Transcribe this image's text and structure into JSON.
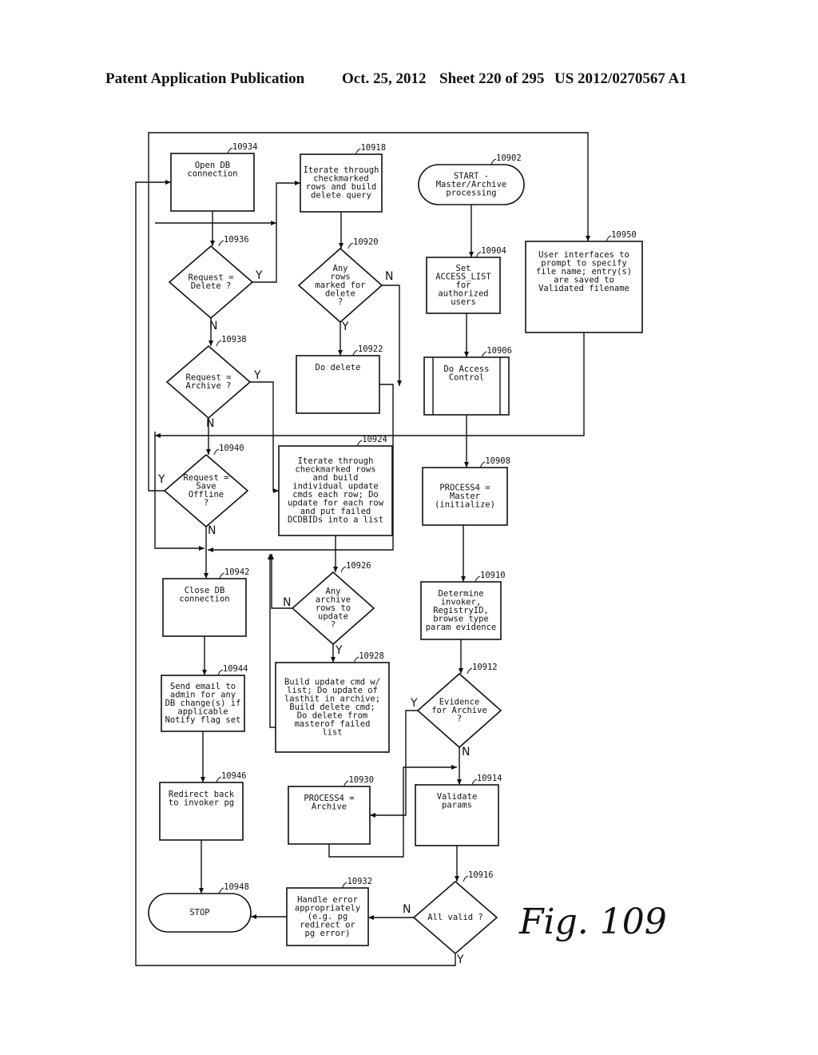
{
  "header": {
    "publication": "Patent Application Publication",
    "date": "Oct. 25, 2012",
    "sheet": "Sheet 220 of 295",
    "patent_number": "US 2012/0270567 A1"
  },
  "figure_label": "Fig. 109",
  "nodes": {
    "n10902": {
      "ref": "10902",
      "type": "terminal",
      "lines": [
        "START -",
        "Master/Archive",
        "processing"
      ]
    },
    "n10904": {
      "ref": "10904",
      "type": "process",
      "lines": [
        "Set",
        "ACCESS_LIST",
        "for",
        "authorized",
        "users"
      ]
    },
    "n10906": {
      "ref": "10906",
      "type": "predefined-process",
      "lines": [
        "Do Access",
        "Control"
      ]
    },
    "n10908": {
      "ref": "10908",
      "type": "process",
      "lines": [
        "PROCESS4 =",
        "Master",
        "(initialize)"
      ]
    },
    "n10910": {
      "ref": "10910",
      "type": "process",
      "lines": [
        "Determine",
        "invoker,",
        "RegistryID,",
        "browse type",
        "param evidence"
      ]
    },
    "n10912": {
      "ref": "10912",
      "type": "decision",
      "lines": [
        "Evidence",
        "for Archive",
        "?"
      ]
    },
    "n10914": {
      "ref": "10914",
      "type": "process",
      "lines": [
        "Validate",
        "params"
      ]
    },
    "n10916": {
      "ref": "10916",
      "type": "decision",
      "lines": [
        "All valid ?"
      ]
    },
    "n10918": {
      "ref": "10918",
      "type": "process",
      "lines": [
        "Iterate through",
        "checkmarked",
        "rows and build",
        "delete query"
      ]
    },
    "n10920": {
      "ref": "10920",
      "type": "decision",
      "lines": [
        "Any",
        "rows",
        "marked for",
        "delete",
        "?"
      ]
    },
    "n10922": {
      "ref": "10922",
      "type": "process",
      "lines": [
        "Do delete"
      ]
    },
    "n10924": {
      "ref": "10924",
      "type": "process",
      "lines": [
        "Iterate through",
        "checkmarked rows",
        "and build",
        "individual update",
        "cmds each row; Do",
        "update for each row",
        "and put failed",
        "DCDBIDs into a list"
      ]
    },
    "n10926": {
      "ref": "10926",
      "type": "decision",
      "lines": [
        "Any",
        "archive",
        "rows to",
        "update",
        "?"
      ]
    },
    "n10928": {
      "ref": "10928",
      "type": "process",
      "lines": [
        "Build update cmd w/",
        "list; Do update of",
        "lasthit in archive;",
        "Build delete cmd;",
        "Do delete from",
        "masterof failed",
        "list"
      ]
    },
    "n10930": {
      "ref": "10930",
      "type": "process",
      "lines": [
        "PROCESS4 =",
        "Archive"
      ]
    },
    "n10932": {
      "ref": "10932",
      "type": "process",
      "lines": [
        "Handle error",
        "appropriately",
        "(e.g. pg",
        "redirect or",
        "pg error)"
      ]
    },
    "n10934": {
      "ref": "10934",
      "type": "process",
      "lines": [
        "Open DB",
        "connection"
      ]
    },
    "n10936": {
      "ref": "10936",
      "type": "decision",
      "lines": [
        "Request =",
        "Delete ?"
      ]
    },
    "n10938": {
      "ref": "10938",
      "type": "decision",
      "lines": [
        "Request =",
        "Archive ?"
      ]
    },
    "n10940": {
      "ref": "10940",
      "type": "decision",
      "lines": [
        "Request =",
        "Save",
        "Offline",
        "?"
      ]
    },
    "n10942": {
      "ref": "10942",
      "type": "process",
      "lines": [
        "Close DB",
        "connection"
      ]
    },
    "n10944": {
      "ref": "10944",
      "type": "process",
      "lines": [
        "Send email to",
        "admin for any",
        "DB change(s) if",
        "applicable",
        "Notify flag set"
      ]
    },
    "n10946": {
      "ref": "10946",
      "type": "process",
      "lines": [
        "Redirect back",
        "to invoker pg"
      ]
    },
    "n10948": {
      "ref": "10948",
      "type": "terminal",
      "lines": [
        "STOP"
      ]
    },
    "n10950": {
      "ref": "10950",
      "type": "process",
      "lines": [
        "User interfaces to",
        "prompt to specify",
        "file name; entry(s)",
        "are saved to",
        "Validated filename"
      ]
    }
  },
  "branch_labels": {
    "yes": "Y",
    "no": "N"
  },
  "edges": [
    {
      "from": "10902",
      "to": "10904"
    },
    {
      "from": "10904",
      "to": "10906"
    },
    {
      "from": "10906",
      "to": "10908"
    },
    {
      "from": "10908",
      "to": "10910"
    },
    {
      "from": "10910",
      "to": "10912"
    },
    {
      "from": "10912",
      "to": "10930",
      "label": "Y"
    },
    {
      "from": "10912",
      "to": "10914",
      "label": "N"
    },
    {
      "from": "10930",
      "to": "10914"
    },
    {
      "from": "10914",
      "to": "10916"
    },
    {
      "from": "10916",
      "to": "10932",
      "label": "N"
    },
    {
      "from": "10916",
      "to": "10934",
      "label": "Y"
    },
    {
      "from": "10932",
      "to": "10948"
    },
    {
      "from": "10934",
      "to": "10936"
    },
    {
      "from": "10936",
      "to": "10918",
      "label": "Y"
    },
    {
      "from": "10936",
      "to": "10938",
      "label": "N"
    },
    {
      "from": "10918",
      "to": "10920"
    },
    {
      "from": "10920",
      "to": "10922",
      "label": "Y"
    },
    {
      "from": "10920",
      "to": "10942",
      "label": "N"
    },
    {
      "from": "10922",
      "to": "10942"
    },
    {
      "from": "10938",
      "to": "10924",
      "label": "Y"
    },
    {
      "from": "10938",
      "to": "10940",
      "label": "N"
    },
    {
      "from": "10924",
      "to": "10926"
    },
    {
      "from": "10926",
      "to": "10928",
      "label": "Y"
    },
    {
      "from": "10926",
      "to": "10942",
      "label": "N"
    },
    {
      "from": "10928",
      "to": "10942"
    },
    {
      "from": "10940",
      "to": "10950",
      "label": "Y"
    },
    {
      "from": "10940",
      "to": "10942",
      "label": "N"
    },
    {
      "from": "10950",
      "to": "10942"
    },
    {
      "from": "10942",
      "to": "10944"
    },
    {
      "from": "10944",
      "to": "10946"
    },
    {
      "from": "10946",
      "to": "10948"
    }
  ]
}
